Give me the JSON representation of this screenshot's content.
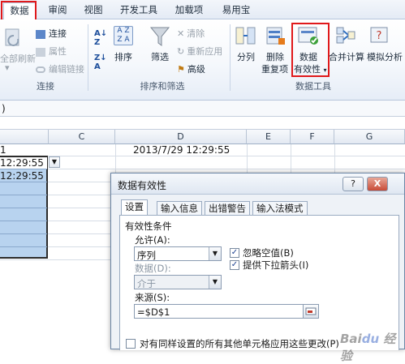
{
  "tabs": [
    "数据",
    "审阅",
    "视图",
    "开发工具",
    "加载项",
    "易用宝"
  ],
  "ribbon": {
    "connections": {
      "refresh_all": "全部刷新",
      "connections": "连接",
      "properties": "属性",
      "edit_links": "编辑链接",
      "group": "连接"
    },
    "sort_filter": {
      "sort": "排序",
      "filter": "筛选",
      "clear": "清除",
      "reapply": "重新应用",
      "advanced": "高级",
      "group": "排序和筛选"
    },
    "data_tools": {
      "text_to_columns": "分列",
      "remove_dup_line1": "删除",
      "remove_dup_line2": "重复项",
      "validation_line1": "数据",
      "validation_line2": "有效性",
      "consolidate": "合并计算",
      "what_if": "模拟分析",
      "group": "数据工具"
    }
  },
  "formula_bar": {
    "value": ")"
  },
  "columns": [
    "C",
    "D",
    "E",
    "F",
    "G"
  ],
  "cells": {
    "d1": "2013/7/29 12:29:55",
    "b1_partial": "1",
    "b2_partial": "12:29:55",
    "b3_partial": "12:29:55"
  },
  "dialog": {
    "title": "数据有效性",
    "help_btn": "?",
    "close_btn": "X",
    "tabs": [
      "设置",
      "输入信息",
      "出错警告",
      "输入法模式"
    ],
    "section": "有效性条件",
    "allow_label": "允许(A):",
    "allow_value": "序列",
    "data_label": "数据(D):",
    "data_value": "介于",
    "ignore_blank": "忽略空值(B)",
    "dropdown": "提供下拉箭头(I)",
    "source_label": "来源(S):",
    "source_value": "=$D$1",
    "apply_all": "对有同样设置的所有其他单元格应用这些更改(P)"
  },
  "watermark": "Baidu 经验",
  "colors": {
    "accent_red": "#e0191b",
    "selection_blue": "#b8d3ef",
    "ribbon_border": "#b7c6dc"
  }
}
